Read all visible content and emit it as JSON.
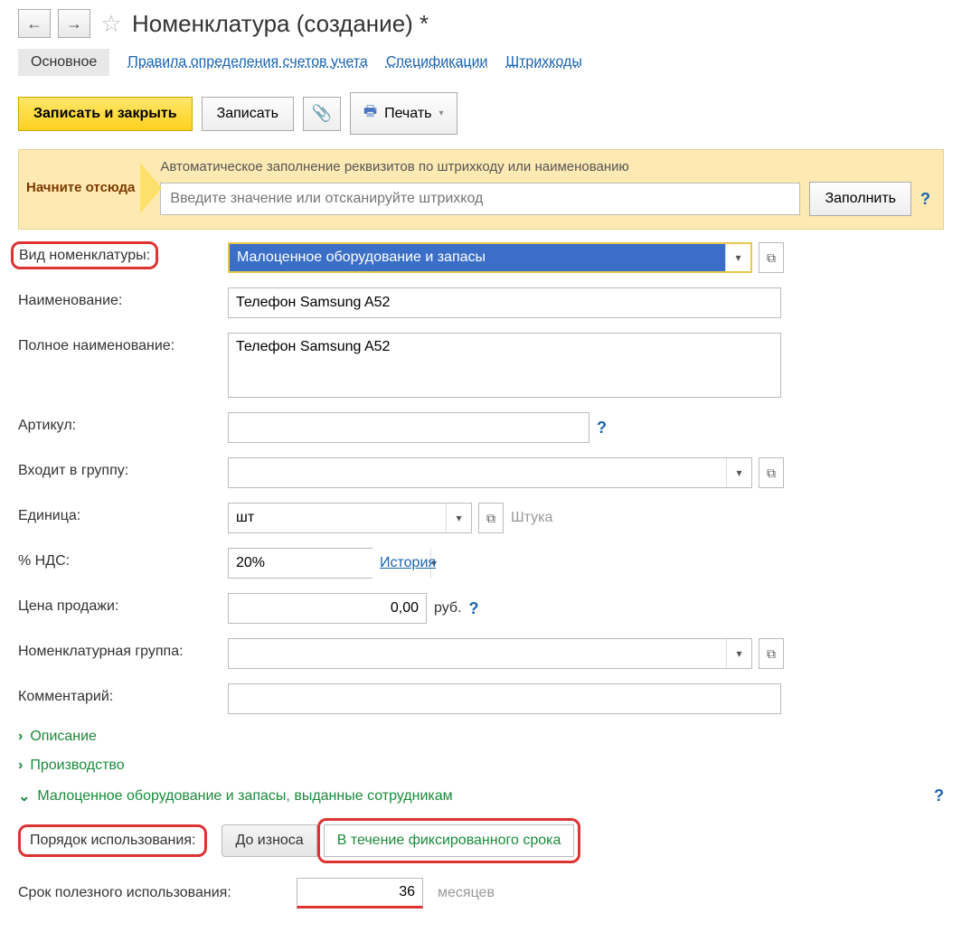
{
  "header": {
    "title": "Номенклатура (создание) *"
  },
  "tabs": {
    "active": "Основное",
    "links": {
      "rules": "Правила определения счетов учета",
      "specs": "Спецификации",
      "barcodes": "Штрихкоды"
    }
  },
  "toolbar": {
    "save_close": "Записать и закрыть",
    "save": "Записать",
    "print": "Печать"
  },
  "banner": {
    "start_label": "Начните отсюда",
    "description": "Автоматическое заполнение реквизитов по штрихкоду или наименованию",
    "input_placeholder": "Введите значение или отсканируйте штрихкод",
    "fill_btn": "Заполнить"
  },
  "form": {
    "vid_label": "Вид номенклатуры:",
    "vid_value": "Малоценное оборудование и запасы",
    "name_label": "Наименование:",
    "name_value": "Телефон Samsung A52",
    "fullname_label": "Полное наименование:",
    "fullname_value": "Телефон Samsung A52",
    "artikul_label": "Артикул:",
    "artikul_value": "",
    "group_label": "Входит в группу:",
    "group_value": "",
    "unit_label": "Единица:",
    "unit_value": "шт",
    "unit_hint": "Штука",
    "vat_label": "% НДС:",
    "vat_value": "20%",
    "vat_history": "История",
    "price_label": "Цена продажи:",
    "price_value": "0,00",
    "price_currency": "руб.",
    "nomgroup_label": "Номенклатурная группа:",
    "nomgroup_value": "",
    "comment_label": "Комментарий:",
    "comment_value": ""
  },
  "expanders": {
    "description": "Описание",
    "production": "Производство",
    "malo": "Малоценное оборудование и запасы, выданные сотрудникам"
  },
  "usage": {
    "order_label": "Порядок использования:",
    "opt_wear": "До износа",
    "opt_fixed": "В течение фиксированного срока",
    "srok_label": "Срок полезного использования:",
    "srok_value": "36",
    "srok_unit": "месяцев"
  }
}
